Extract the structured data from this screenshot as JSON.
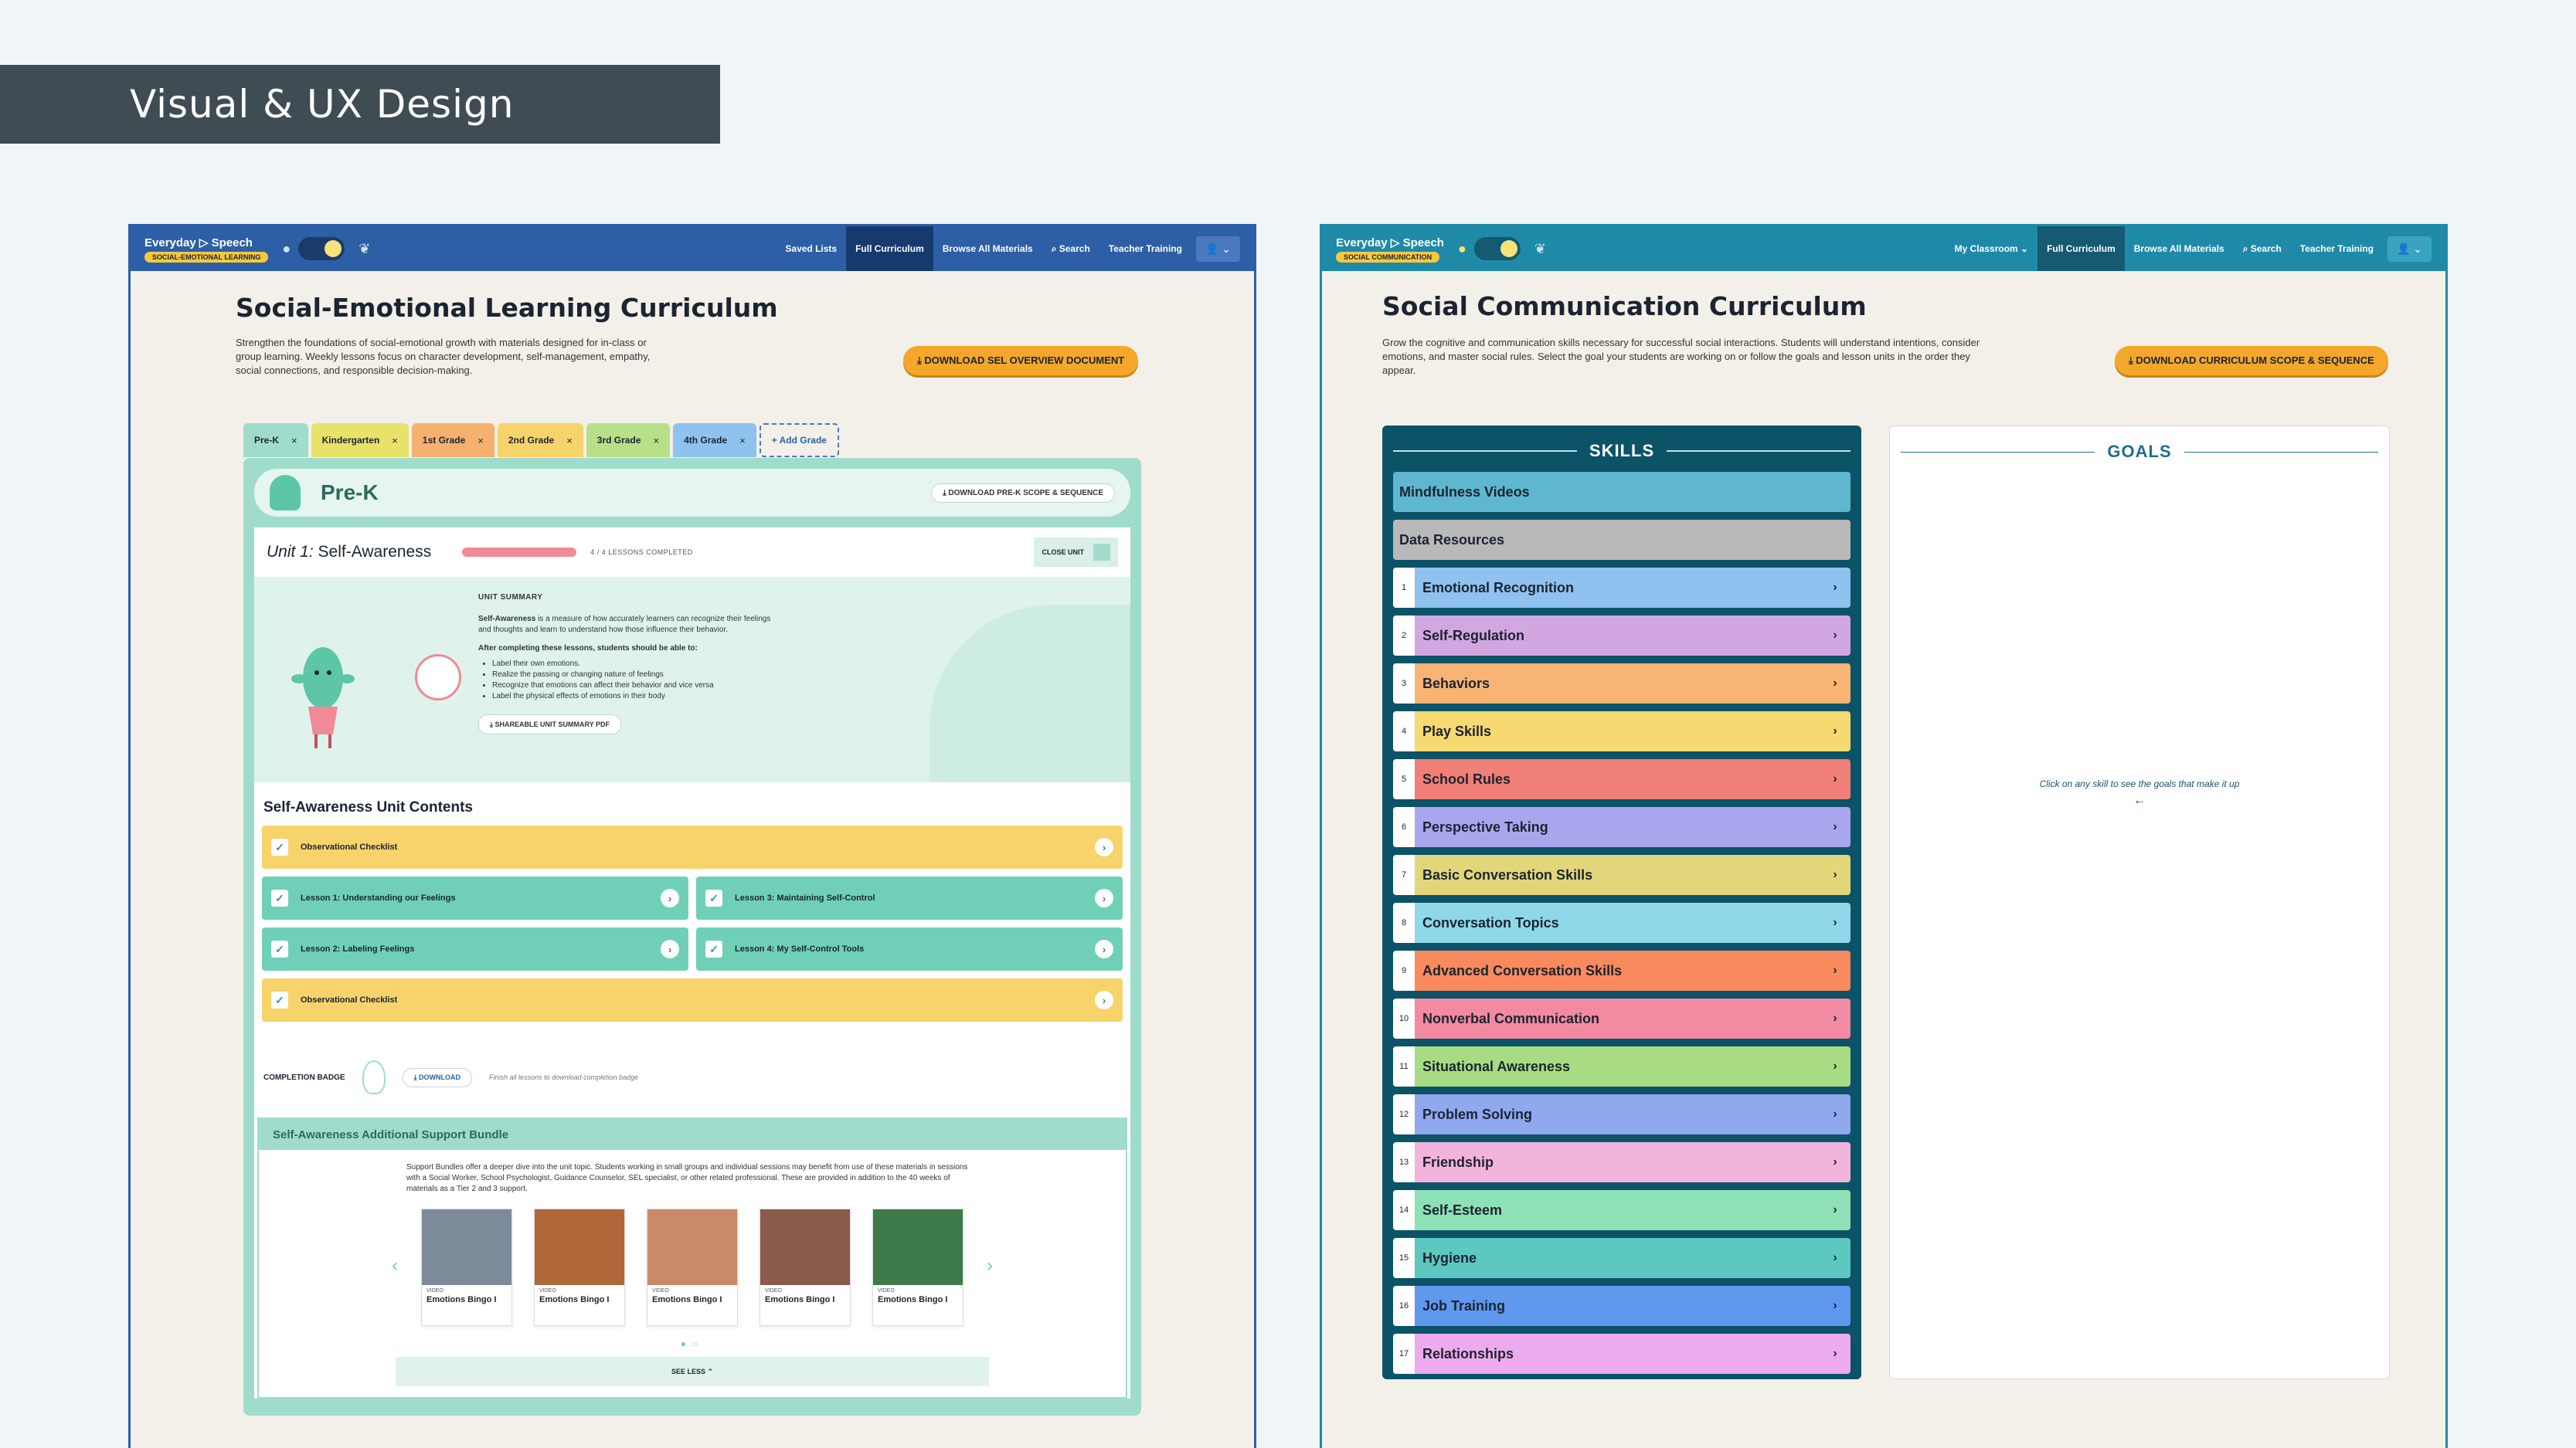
{
  "banner": {
    "title": "Visual & UX Design"
  },
  "left": {
    "logo": {
      "brand": "Everyday ▷ Speech",
      "pill": "SOCIAL-EMOTIONAL LEARNING"
    },
    "nav": [
      "Saved Lists",
      "Full Curriculum",
      "Browse All Materials",
      "⌕ Search",
      "Teacher Training"
    ],
    "user_label": "👤 ⌄",
    "title": "Social-Emotional Learning Curriculum",
    "description": "Strengthen the foundations of social-emotional growth with materials designed for in-class or group learning. Weekly lessons focus on character development, self-management, empathy, social connections, and responsible decision-making.",
    "cta": "⤓  DOWNLOAD SEL OVERVIEW DOCUMENT",
    "tabs": [
      {
        "label": "Pre-K",
        "color": "#9fdccc"
      },
      {
        "label": "Kindergarten",
        "color": "#e8e26a"
      },
      {
        "label": "1st Grade",
        "color": "#f6b070"
      },
      {
        "label": "2nd Grade",
        "color": "#f7d36c"
      },
      {
        "label": "3rd Grade",
        "color": "#b8e08a"
      },
      {
        "label": "4th Grade",
        "color": "#8fc2ee"
      }
    ],
    "add_grade": "+ Add Grade",
    "grade": {
      "name": "Pre-K",
      "scope_btn": "⤓  DOWNLOAD PRE-K SCOPE & SEQUENCE",
      "unit_prefix": "Unit 1:",
      "unit_name": "Self-Awareness",
      "progress_text": "4 / 4 LESSONS COMPLETED",
      "close_unit": "CLOSE UNIT",
      "summary_heading": "UNIT SUMMARY",
      "summary_lead": "Self-Awareness",
      "summary_body": " is a measure of how accurately learners can recognize their feelings and thoughts and learn to understand how those influence their behavior.",
      "summary_after": "After completing these lessons, students should be able to:",
      "objectives": [
        "Label their own emotions.",
        "Realize the passing or changing nature of feelings",
        "Recognize that emotions can affect their behavior and vice versa",
        "Label the physical effects of emotions in their body"
      ],
      "pdf_btn": "⤓  SHAREABLE UNIT SUMMARY PDF",
      "contents_title": "Self-Awareness Unit Contents",
      "rows": [
        [
          {
            "label": "Observational Checklist",
            "color": "yellow"
          }
        ],
        [
          {
            "label": "Lesson 1: Understanding our Feelings",
            "color": "teal"
          },
          {
            "label": "Lesson 3: Maintaining Self-Control",
            "color": "teal"
          }
        ],
        [
          {
            "label": "Lesson 2: Labeling Feelings",
            "color": "teal"
          },
          {
            "label": "Lesson 4: My Self-Control Tools",
            "color": "teal"
          }
        ],
        [
          {
            "label": "Observational Checklist",
            "color": "yellow"
          }
        ]
      ],
      "completion_label": "COMPLETION BADGE",
      "completion_btn": "⤓ DOWNLOAD",
      "completion_note": "Finish all lessons to download completion badge",
      "bundle_title": "Self-Awareness Additional Support Bundle",
      "bundle_desc": "Support Bundles offer a deeper dive into the unit topic. Students working in small groups and individual sessions may benefit from use of these materials in sessions with a Social Worker, School Psychologist, Guidance Counselor, SEL specialist, or other related professional. These are provided in addition to the 40 weeks of materials as a Tier 2 and 3 support.",
      "videos": [
        {
          "tag": "VIDEO",
          "title": "Emotions Bingo I",
          "color": "#7c8a9a"
        },
        {
          "tag": "VIDEO",
          "title": "Emotions Bingo I",
          "color": "#b0683a"
        },
        {
          "tag": "VIDEO",
          "title": "Emotions Bingo I",
          "color": "#c98a6a"
        },
        {
          "tag": "VIDEO",
          "title": "Emotions Bingo I",
          "color": "#8a5a4a"
        },
        {
          "tag": "VIDEO",
          "title": "Emotions Bingo I",
          "color": "#3f7a4a"
        }
      ],
      "see_less": "SEE LESS  ⌃"
    }
  },
  "right": {
    "logo": {
      "brand": "Everyday ▷ Speech",
      "pill": "SOCIAL COMMUNICATION"
    },
    "nav": [
      "My Classroom ⌄",
      "Full Curriculum",
      "Browse All Materials",
      "⌕ Search",
      "Teacher Training"
    ],
    "user_label": "👤 ⌄",
    "title": "Social Communication Curriculum",
    "description": "Grow the cognitive and communication skills necessary for successful social interactions. Students will understand intentions, consider emotions, and master social rules. Select the goal your students are working on or follow the goals and lesson units in the order they appear.",
    "cta": "⤓  DOWNLOAD CURRICULUM SCOPE & SEQUENCE",
    "skills_title": "SKILLS",
    "goals_title": "GOALS",
    "goals_hint": "Click on any skill to see the goals that make it up",
    "plain_items": [
      {
        "label": "Mindfulness Videos",
        "color": "#5fb7cf"
      },
      {
        "label": "Data Resources",
        "color": "#b9b9b9"
      }
    ],
    "skills": [
      {
        "num": "1",
        "label": "Emotional Recognition",
        "color": "#8fc2ee"
      },
      {
        "num": "2",
        "label": "Self-Regulation",
        "color": "#d2a6e0"
      },
      {
        "num": "3",
        "label": "Behaviors",
        "color": "#f8b474"
      },
      {
        "num": "4",
        "label": "Play Skills",
        "color": "#f6d970"
      },
      {
        "num": "5",
        "label": "School Rules",
        "color": "#f07f78"
      },
      {
        "num": "6",
        "label": "Perspective Taking",
        "color": "#aaa6ee"
      },
      {
        "num": "7",
        "label": "Basic Conversation Skills",
        "color": "#e3d67a"
      },
      {
        "num": "8",
        "label": "Conversation Topics",
        "color": "#8fd8ea"
      },
      {
        "num": "9",
        "label": "Advanced Conversation Skills",
        "color": "#f88a5e"
      },
      {
        "num": "10",
        "label": "Nonverbal Communication",
        "color": "#f28aa2"
      },
      {
        "num": "11",
        "label": "Situational Awareness",
        "color": "#a8dc82"
      },
      {
        "num": "12",
        "label": "Problem Solving",
        "color": "#8fa8ee"
      },
      {
        "num": "13",
        "label": "Friendship",
        "color": "#f2b4dc"
      },
      {
        "num": "14",
        "label": "Self-Esteem",
        "color": "#8ee0b6"
      },
      {
        "num": "15",
        "label": "Hygiene",
        "color": "#5cc8c0"
      },
      {
        "num": "16",
        "label": "Job Training",
        "color": "#5f98ec"
      },
      {
        "num": "17",
        "label": "Relationships",
        "color": "#eeaaee"
      }
    ]
  }
}
